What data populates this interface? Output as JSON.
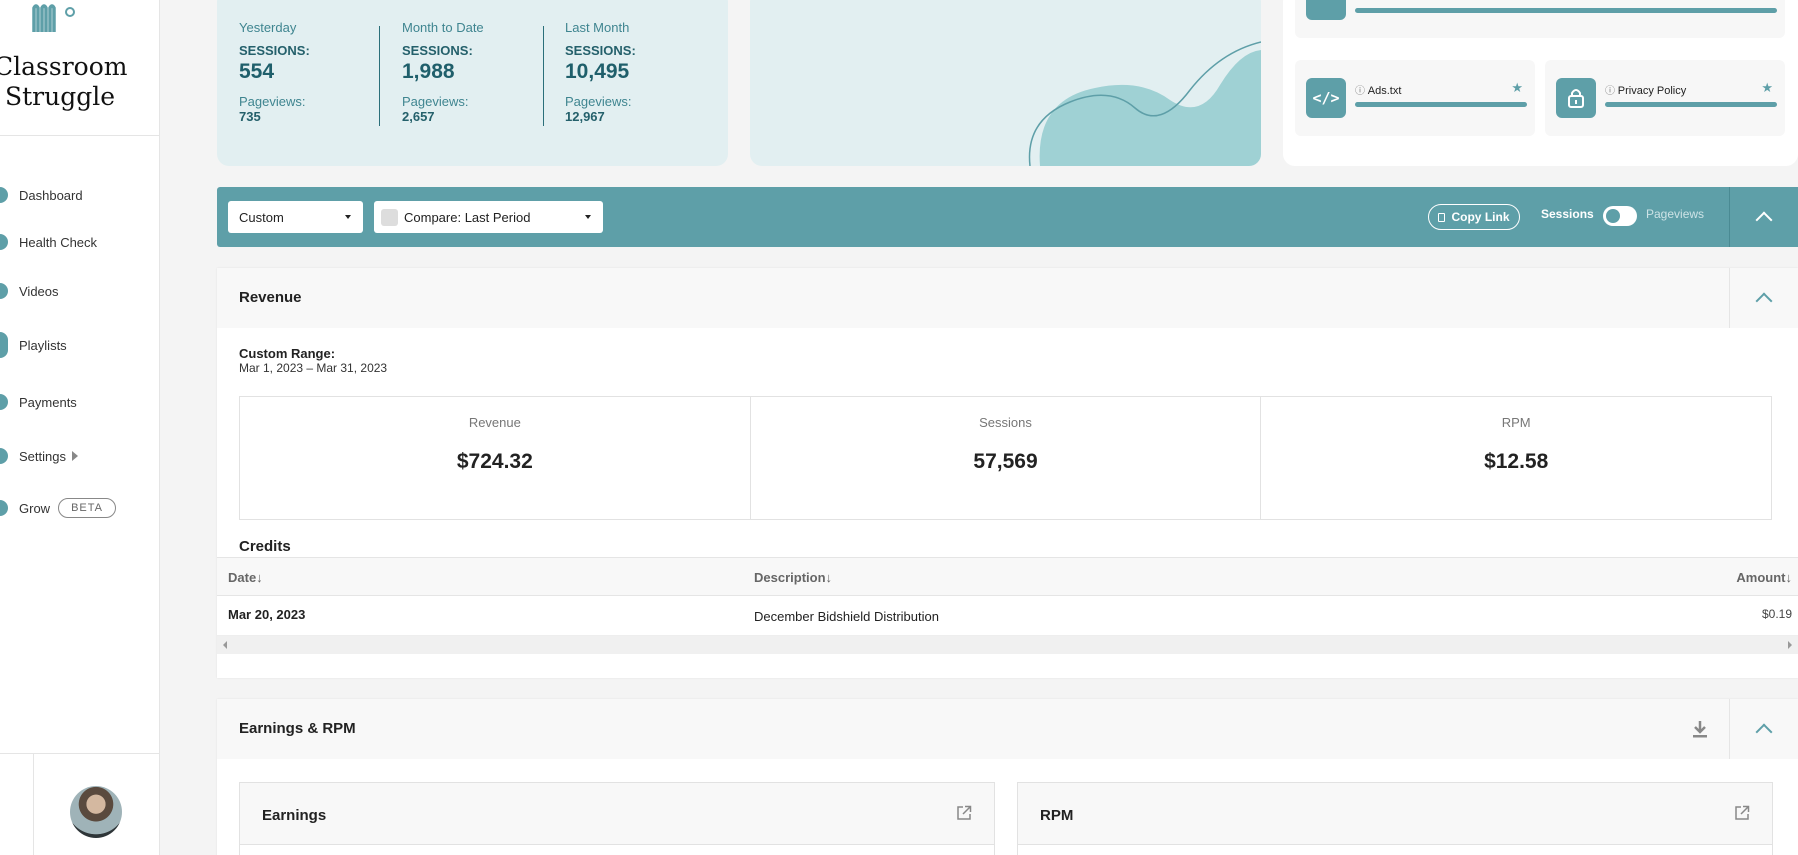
{
  "brand": {
    "name_line1": "Classroom",
    "name_line2": "Struggle"
  },
  "sidebar": {
    "items": [
      {
        "label": "Dashboard"
      },
      {
        "label": "Health Check"
      },
      {
        "label": "Videos"
      },
      {
        "label": "Playlists"
      },
      {
        "label": "Payments"
      },
      {
        "label": "Settings"
      },
      {
        "label": "Grow",
        "badge": "BETA"
      }
    ]
  },
  "stats": [
    {
      "period": "Yesterday",
      "sessions_label": "SESSIONS:",
      "sessions": "554",
      "pageviews_label": "Pageviews:",
      "pageviews": "735"
    },
    {
      "period": "Month to Date",
      "sessions_label": "SESSIONS:",
      "sessions": "1,988",
      "pageviews_label": "Pageviews:",
      "pageviews": "2,657"
    },
    {
      "period": "Last Month",
      "sessions_label": "SESSIONS:",
      "sessions": "10,495",
      "pageviews_label": "Pageviews:",
      "pageviews": "12,967"
    }
  ],
  "tools": [
    {
      "name": "Ads.txt",
      "icon": "code-icon"
    },
    {
      "name": "Privacy Policy",
      "icon": "lock-icon"
    }
  ],
  "filters": {
    "range": "Custom",
    "compare": "Compare: Last Period",
    "copy_link": "Copy Link",
    "toggle_on": "Sessions",
    "toggle_off": "Pageviews"
  },
  "revenue": {
    "title": "Revenue",
    "range_label": "Custom Range:",
    "range_value": "Mar 1, 2023 – Mar 31, 2023",
    "metrics": [
      {
        "label": "Revenue",
        "value": "$724.32"
      },
      {
        "label": "Sessions",
        "value": "57,569"
      },
      {
        "label": "RPM",
        "value": "$12.58"
      }
    ],
    "credits_title": "Credits",
    "columns": {
      "date": "Date↓",
      "description": "Description↓",
      "amount": "Amount↓"
    },
    "rows": [
      {
        "date": "Mar 20, 2023",
        "description": "December Bidshield Distribution",
        "amount": "$0.19"
      }
    ]
  },
  "earnings": {
    "title": "Earnings & RPM",
    "cards": [
      {
        "title": "Earnings"
      },
      {
        "title": "RPM"
      }
    ]
  },
  "colors": {
    "accent": "#5e9fa8",
    "card_bg": "#e2eff1",
    "text_teal": "#1f5f6b"
  }
}
